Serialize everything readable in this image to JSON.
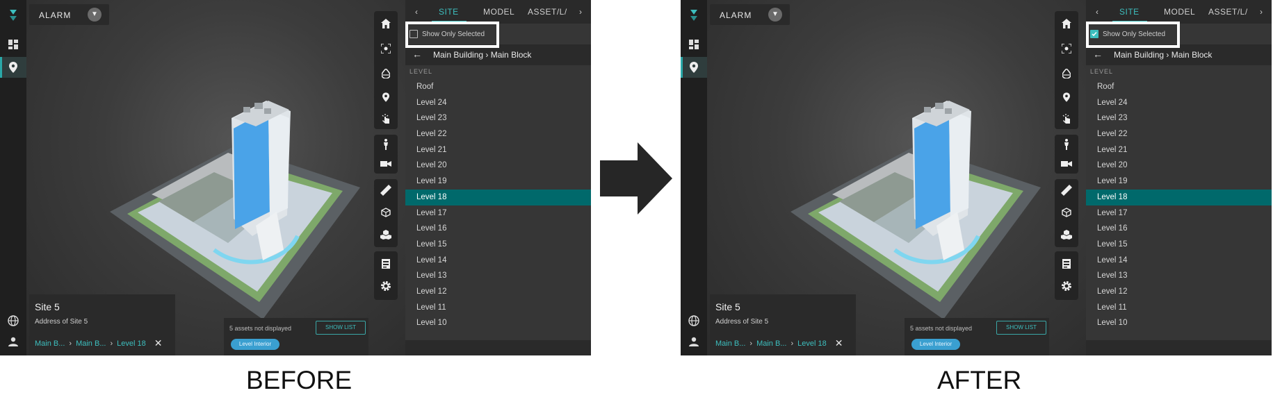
{
  "captions": {
    "before": "BEFORE",
    "after": "AFTER"
  },
  "app": {
    "alarm_label": "ALARM",
    "tabs": [
      {
        "label": "SITE",
        "active": true
      },
      {
        "label": "MODEL",
        "active": false
      },
      {
        "label": "ASSET/L/",
        "active": false
      }
    ],
    "site": {
      "name": "Site 5",
      "address": "Address of Site 5",
      "breadcrumbs": [
        "Main B...",
        "Main B...",
        "Level 18"
      ]
    },
    "assets": {
      "message": "5 assets not displayed",
      "show_list": "SHOW LIST",
      "pill": "Level Interior"
    },
    "path": {
      "building": "Main Building",
      "block": "Main Block"
    },
    "level_header": "LEVEL",
    "levels": [
      "Roof",
      "Level 24",
      "Level 23",
      "Level 22",
      "Level 21",
      "Level 20",
      "Level 19",
      "Level 18",
      "Level 17",
      "Level 16",
      "Level 15",
      "Level 14",
      "Level 13",
      "Level 12",
      "Level 11",
      "Level 10"
    ],
    "selected_level": "Level 18",
    "show_only_selected_label": "Show Only Selected"
  },
  "states": {
    "before": {
      "show_only_selected": false
    },
    "after": {
      "show_only_selected": true
    }
  },
  "colors": {
    "accent": "#3dbfbf",
    "selected_row": "#00696b",
    "building_glass": "#4aa3e8"
  },
  "icons": {
    "left_rail": [
      "logo-icon",
      "dashboard-icon",
      "location-pin-icon",
      "globe-icon",
      "user-icon"
    ],
    "toolbar": [
      "home-icon",
      "focus-icon",
      "drop-icon",
      "pin-icon",
      "touch-icon",
      "person-icon",
      "camera-icon",
      "ruler-icon",
      "cube-section-icon",
      "cubes-icon",
      "report-icon",
      "settings-icon"
    ]
  }
}
